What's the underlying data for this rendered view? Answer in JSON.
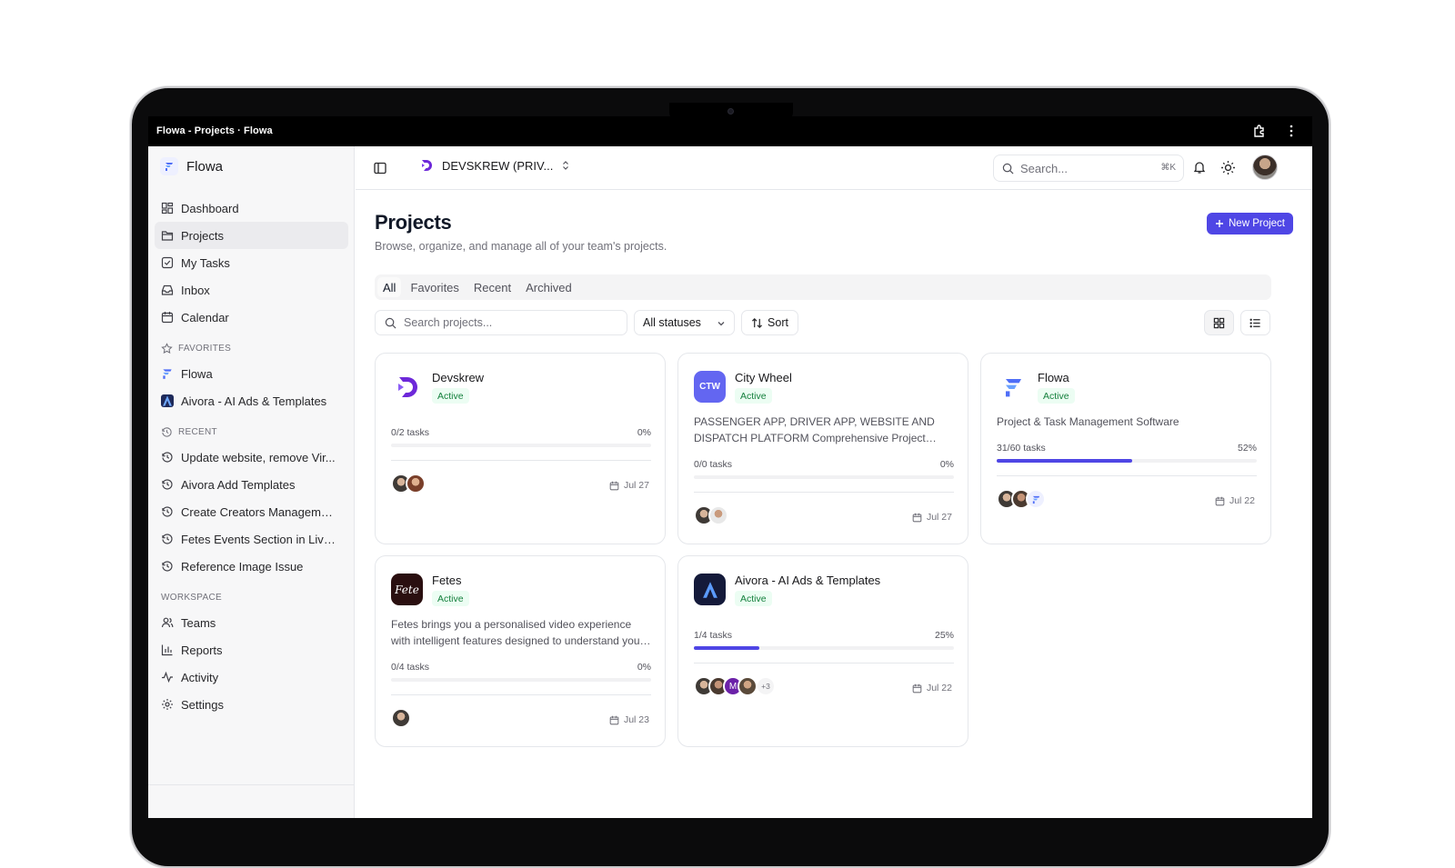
{
  "browser": {
    "title": "Flowa - Projects · Flowa"
  },
  "brand": {
    "name": "Flowa"
  },
  "sidebar": {
    "nav": [
      {
        "label": "Dashboard",
        "icon": "dashboard-icon"
      },
      {
        "label": "Projects",
        "icon": "folder-icon",
        "active": true
      },
      {
        "label": "My Tasks",
        "icon": "checkbox-icon"
      },
      {
        "label": "Inbox",
        "icon": "inbox-icon"
      },
      {
        "label": "Calendar",
        "icon": "calendar-icon"
      }
    ],
    "favorites_label": "FAVORITES",
    "favorites": [
      {
        "label": "Flowa"
      },
      {
        "label": "Aivora - AI Ads & Templates"
      }
    ],
    "recent_label": "RECENT",
    "recent": [
      {
        "label": "Update website, remove Vir..."
      },
      {
        "label": "Aivora Add Templates"
      },
      {
        "label": "Create Creators Manageme..."
      },
      {
        "label": "Fetes Events Section in Live ..."
      },
      {
        "label": "Reference Image Issue"
      }
    ],
    "workspace_label": "WORKSPACE",
    "workspace": [
      {
        "label": "Teams",
        "icon": "users-icon"
      },
      {
        "label": "Reports",
        "icon": "bar-chart-icon"
      },
      {
        "label": "Activity",
        "icon": "activity-icon"
      },
      {
        "label": "Settings",
        "icon": "gear-icon"
      }
    ]
  },
  "topbar": {
    "workspace_name": "DEVSKREW (PRIV...",
    "search_placeholder": "Search...",
    "search_shortcut": "⌘K"
  },
  "page": {
    "title": "Projects",
    "subtitle": "Browse, organize, and manage all of your team's projects.",
    "new_project_label": "New Project",
    "tabs": [
      "All",
      "Favorites",
      "Recent",
      "Archived"
    ],
    "active_tab": "All",
    "search_placeholder": "Search projects...",
    "status_filter": "All statuses",
    "sort_label": "Sort"
  },
  "projects": [
    {
      "name": "Devskrew",
      "status": "Active",
      "description": "",
      "tasks": "0/2 tasks",
      "percent_label": "0%",
      "progress": 0,
      "due": "Jul 27",
      "icon": "devskrew-logo",
      "avatars": 2,
      "more": ""
    },
    {
      "name": "City Wheel",
      "status": "Active",
      "icon_text": "CTW",
      "description": "PASSENGER APP, DRIVER APP, WEBSITE AND DISPATCH PLATFORM Comprehensive Project Management for City Wheel",
      "tasks": "0/0 tasks",
      "percent_label": "0%",
      "progress": 0,
      "due": "Jul 27",
      "icon": "citywheel-logo",
      "avatars": 2,
      "more": ""
    },
    {
      "name": "Flowa",
      "status": "Active",
      "description": "Project & Task Management Software",
      "tasks": "31/60 tasks",
      "percent_label": "52%",
      "progress": 0.52,
      "due": "Jul 22",
      "icon": "flowa-logo",
      "avatars": 3,
      "more": ""
    },
    {
      "name": "Fetes",
      "status": "Active",
      "icon_text": "Fete",
      "description": "Fetes brings you a personalised video experience with intelligent features designed to understand your celebrations",
      "tasks": "0/4 tasks",
      "percent_label": "0%",
      "progress": 0,
      "due": "Jul 23",
      "icon": "fetes-logo",
      "avatars": 1,
      "more": ""
    },
    {
      "name": "Aivora - AI Ads & Templates",
      "status": "Active",
      "description": "",
      "tasks": "1/4 tasks",
      "percent_label": "25%",
      "progress": 0.25,
      "due": "Jul 22",
      "icon": "aivora-logo",
      "avatars": 4,
      "avatar_letter": "M",
      "more": "+3"
    }
  ],
  "colors": {
    "accent": "#4f46e5",
    "active_badge_bg": "#ecfdf3",
    "active_badge_text": "#15803d"
  }
}
